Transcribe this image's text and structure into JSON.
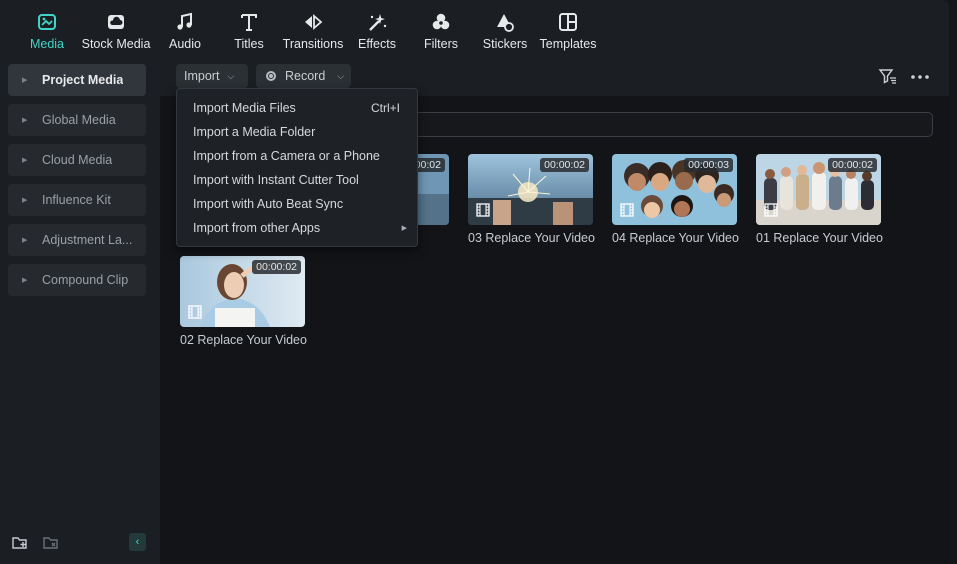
{
  "toolbar": {
    "items": [
      {
        "label": "Media",
        "icon": "media-icon",
        "active": true
      },
      {
        "label": "Stock Media",
        "icon": "cloud-box-icon"
      },
      {
        "label": "Audio",
        "icon": "music-note-icon"
      },
      {
        "label": "Titles",
        "icon": "text-t-icon"
      },
      {
        "label": "Transitions",
        "icon": "transition-arrows-icon"
      },
      {
        "label": "Effects",
        "icon": "sparkle-wand-icon"
      },
      {
        "label": "Filters",
        "icon": "filter-circles-icon"
      },
      {
        "label": "Stickers",
        "icon": "sticker-icon"
      },
      {
        "label": "Templates",
        "icon": "template-grid-icon"
      }
    ],
    "accent_color": "#3fd6c9"
  },
  "sidebar": {
    "items": [
      {
        "label": "Project Media",
        "active": true
      },
      {
        "label": "Global Media"
      },
      {
        "label": "Cloud Media"
      },
      {
        "label": "Influence Kit"
      },
      {
        "label": "Adjustment La..."
      },
      {
        "label": "Compound Clip"
      }
    ],
    "bottom_icons": [
      "new-folder-icon",
      "delete-folder-icon",
      "collapse-left-icon"
    ]
  },
  "main": {
    "import_label": "Import",
    "record_label": "Record",
    "filter_icon": "filter-icon",
    "more_icon": "more-dots-icon"
  },
  "import_menu": {
    "items": [
      {
        "label": "Import Media Files",
        "shortcut": "Ctrl+I"
      },
      {
        "label": "Import a Media Folder"
      },
      {
        "label": "Import from a Camera or a Phone"
      },
      {
        "label": "Import with Instant Cutter Tool"
      },
      {
        "label": "Import with Auto Beat Sync"
      },
      {
        "label": "Import from other Apps",
        "submenu": true
      }
    ]
  },
  "media_items": [
    {
      "caption": "ideo",
      "duration": ":00:02"
    },
    {
      "caption": "03 Replace Your Video",
      "duration": "00:00:02"
    },
    {
      "caption": "04 Replace Your Video",
      "duration": "00:00:03"
    },
    {
      "caption": "01 Replace Your Video",
      "duration": "00:00:02"
    },
    {
      "caption": "02 Replace Your Video",
      "duration": "00:00:02"
    }
  ]
}
